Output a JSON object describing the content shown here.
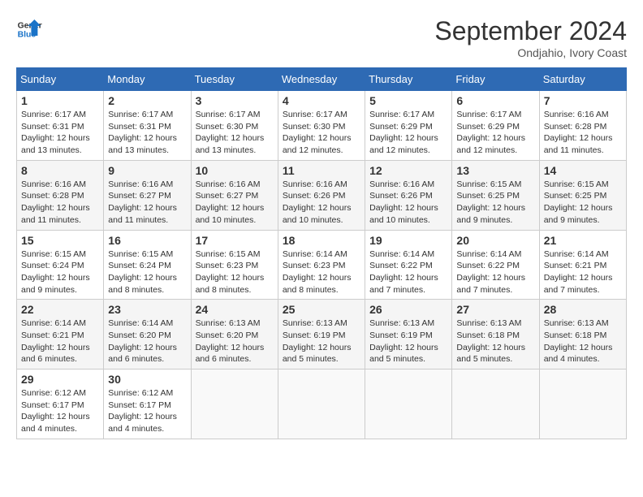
{
  "header": {
    "logo_line1": "General",
    "logo_line2": "Blue",
    "month": "September 2024",
    "location": "Ondjahio, Ivory Coast"
  },
  "days_of_week": [
    "Sunday",
    "Monday",
    "Tuesday",
    "Wednesday",
    "Thursday",
    "Friday",
    "Saturday"
  ],
  "weeks": [
    [
      {
        "day": "1",
        "info": "Sunrise: 6:17 AM\nSunset: 6:31 PM\nDaylight: 12 hours\nand 13 minutes."
      },
      {
        "day": "2",
        "info": "Sunrise: 6:17 AM\nSunset: 6:31 PM\nDaylight: 12 hours\nand 13 minutes."
      },
      {
        "day": "3",
        "info": "Sunrise: 6:17 AM\nSunset: 6:30 PM\nDaylight: 12 hours\nand 13 minutes."
      },
      {
        "day": "4",
        "info": "Sunrise: 6:17 AM\nSunset: 6:30 PM\nDaylight: 12 hours\nand 12 minutes."
      },
      {
        "day": "5",
        "info": "Sunrise: 6:17 AM\nSunset: 6:29 PM\nDaylight: 12 hours\nand 12 minutes."
      },
      {
        "day": "6",
        "info": "Sunrise: 6:17 AM\nSunset: 6:29 PM\nDaylight: 12 hours\nand 12 minutes."
      },
      {
        "day": "7",
        "info": "Sunrise: 6:16 AM\nSunset: 6:28 PM\nDaylight: 12 hours\nand 11 minutes."
      }
    ],
    [
      {
        "day": "8",
        "info": "Sunrise: 6:16 AM\nSunset: 6:28 PM\nDaylight: 12 hours\nand 11 minutes."
      },
      {
        "day": "9",
        "info": "Sunrise: 6:16 AM\nSunset: 6:27 PM\nDaylight: 12 hours\nand 11 minutes."
      },
      {
        "day": "10",
        "info": "Sunrise: 6:16 AM\nSunset: 6:27 PM\nDaylight: 12 hours\nand 10 minutes."
      },
      {
        "day": "11",
        "info": "Sunrise: 6:16 AM\nSunset: 6:26 PM\nDaylight: 12 hours\nand 10 minutes."
      },
      {
        "day": "12",
        "info": "Sunrise: 6:16 AM\nSunset: 6:26 PM\nDaylight: 12 hours\nand 10 minutes."
      },
      {
        "day": "13",
        "info": "Sunrise: 6:15 AM\nSunset: 6:25 PM\nDaylight: 12 hours\nand 9 minutes."
      },
      {
        "day": "14",
        "info": "Sunrise: 6:15 AM\nSunset: 6:25 PM\nDaylight: 12 hours\nand 9 minutes."
      }
    ],
    [
      {
        "day": "15",
        "info": "Sunrise: 6:15 AM\nSunset: 6:24 PM\nDaylight: 12 hours\nand 9 minutes."
      },
      {
        "day": "16",
        "info": "Sunrise: 6:15 AM\nSunset: 6:24 PM\nDaylight: 12 hours\nand 8 minutes."
      },
      {
        "day": "17",
        "info": "Sunrise: 6:15 AM\nSunset: 6:23 PM\nDaylight: 12 hours\nand 8 minutes."
      },
      {
        "day": "18",
        "info": "Sunrise: 6:14 AM\nSunset: 6:23 PM\nDaylight: 12 hours\nand 8 minutes."
      },
      {
        "day": "19",
        "info": "Sunrise: 6:14 AM\nSunset: 6:22 PM\nDaylight: 12 hours\nand 7 minutes."
      },
      {
        "day": "20",
        "info": "Sunrise: 6:14 AM\nSunset: 6:22 PM\nDaylight: 12 hours\nand 7 minutes."
      },
      {
        "day": "21",
        "info": "Sunrise: 6:14 AM\nSunset: 6:21 PM\nDaylight: 12 hours\nand 7 minutes."
      }
    ],
    [
      {
        "day": "22",
        "info": "Sunrise: 6:14 AM\nSunset: 6:21 PM\nDaylight: 12 hours\nand 6 minutes."
      },
      {
        "day": "23",
        "info": "Sunrise: 6:14 AM\nSunset: 6:20 PM\nDaylight: 12 hours\nand 6 minutes."
      },
      {
        "day": "24",
        "info": "Sunrise: 6:13 AM\nSunset: 6:20 PM\nDaylight: 12 hours\nand 6 minutes."
      },
      {
        "day": "25",
        "info": "Sunrise: 6:13 AM\nSunset: 6:19 PM\nDaylight: 12 hours\nand 5 minutes."
      },
      {
        "day": "26",
        "info": "Sunrise: 6:13 AM\nSunset: 6:19 PM\nDaylight: 12 hours\nand 5 minutes."
      },
      {
        "day": "27",
        "info": "Sunrise: 6:13 AM\nSunset: 6:18 PM\nDaylight: 12 hours\nand 5 minutes."
      },
      {
        "day": "28",
        "info": "Sunrise: 6:13 AM\nSunset: 6:18 PM\nDaylight: 12 hours\nand 4 minutes."
      }
    ],
    [
      {
        "day": "29",
        "info": "Sunrise: 6:12 AM\nSunset: 6:17 PM\nDaylight: 12 hours\nand 4 minutes."
      },
      {
        "day": "30",
        "info": "Sunrise: 6:12 AM\nSunset: 6:17 PM\nDaylight: 12 hours\nand 4 minutes."
      },
      {
        "day": "",
        "info": ""
      },
      {
        "day": "",
        "info": ""
      },
      {
        "day": "",
        "info": ""
      },
      {
        "day": "",
        "info": ""
      },
      {
        "day": "",
        "info": ""
      }
    ]
  ]
}
